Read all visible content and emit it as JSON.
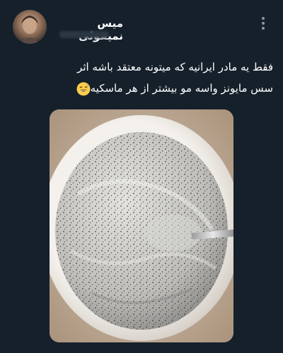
{
  "tweet": {
    "author": {
      "display_name": "میس نمیقولی",
      "avatar_icon": "avatar-image-icon"
    },
    "more_icon": "more-vertical-icon",
    "text_line_1": "فقط یه مادر ایرانیه که میتونه معتقد باشه اثر",
    "text_line_2": "سس مایونز واسه مو بیشتر از هر ماسکیه",
    "emoji_icon": "grinning-sweat-emoji-icon",
    "media_icon": "photo-bowl-of-hair-mask-icon"
  },
  "colors": {
    "background": "#15202b",
    "text": "#ffffff",
    "secondary": "#8b98a5"
  }
}
